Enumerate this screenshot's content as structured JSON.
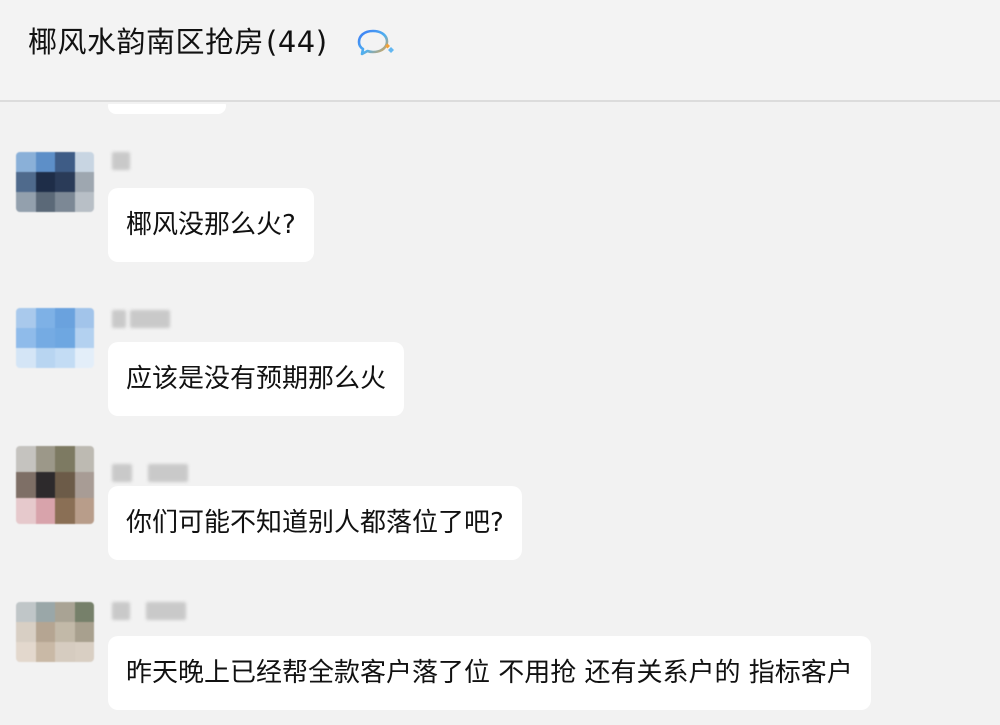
{
  "header": {
    "title": "椰风水韵南区抢房",
    "member_count": "(44)",
    "icon": "chat-bubble-icon"
  },
  "messages": [
    {
      "sender": "",
      "text": "椰风没那么火?",
      "avatar_colors": [
        "#8ab0d8",
        "#5d8fc8",
        "#3e5c86",
        "#c8d5e2",
        "#4f6a8c",
        "#1e2d48",
        "#2a3b58",
        "#9ea7b0",
        "#93a0ad",
        "#5b6978",
        "#7c8895",
        "#b8bfc6"
      ]
    },
    {
      "sender": "",
      "text": "应该是没有预期那么火",
      "avatar_colors": [
        "#a9c9ec",
        "#7eb1e6",
        "#6aa2de",
        "#a2c4ea",
        "#8fbbea",
        "#75abe3",
        "#6ea7e1",
        "#b3d1f0",
        "#d4e5f6",
        "#b8d5f1",
        "#c3dcf4",
        "#e3eef9"
      ]
    },
    {
      "sender": "",
      "text": "你们可能不知道别人都落位了吧?",
      "avatar_colors": [
        "#c5c3bf",
        "#9c9889",
        "#7d7a62",
        "#bdbab2",
        "#7e6f66",
        "#2d2a2c",
        "#6c5b48",
        "#a89c95",
        "#e6c9cc",
        "#d8a3ab",
        "#8a6f55",
        "#b89d8a"
      ]
    },
    {
      "sender": "",
      "text": "昨天晚上已经帮全款客户落了位 不用抢 还有关系户的 指标客户",
      "avatar_colors": [
        "#c0c6c8",
        "#9aa7a8",
        "#a9a394",
        "#76806a",
        "#d8cfc4",
        "#b5a592",
        "#c2b9a8",
        "#a8a08e",
        "#e3d8cd",
        "#c9b9a6",
        "#d6ccc0",
        "#d9cfc3"
      ]
    }
  ]
}
